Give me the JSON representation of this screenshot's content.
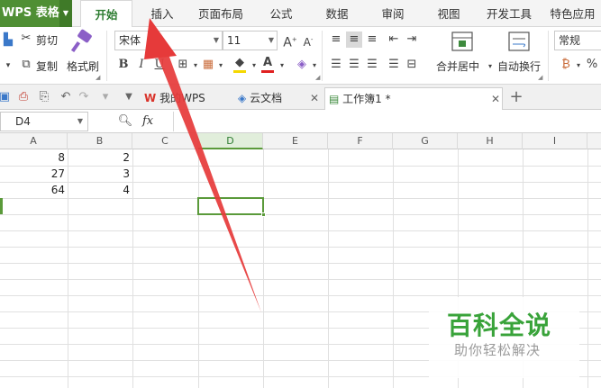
{
  "app": {
    "button_label": "WPS 表格"
  },
  "menu": {
    "tabs": [
      {
        "label": "开始"
      },
      {
        "label": "插入"
      },
      {
        "label": "页面布局"
      },
      {
        "label": "公式"
      },
      {
        "label": "数据"
      },
      {
        "label": "审阅"
      },
      {
        "label": "视图"
      },
      {
        "label": "开发工具"
      },
      {
        "label": "特色应用"
      }
    ],
    "active_tab": "开始"
  },
  "ribbon": {
    "cut_label": "剪切",
    "copy_label": "复制",
    "format_painter_label": "格式刷",
    "font_name": "宋体",
    "font_size": "11",
    "bold": "B",
    "italic": "I",
    "underline": "U",
    "merge_center_label": "合并居中",
    "wrap_text_label": "自动换行",
    "number_format": "常规",
    "percent": "%",
    "font_grow": "A",
    "font_shrink": "A",
    "font_color_letter": "A"
  },
  "doc_tabs": {
    "tabs": [
      {
        "label": "我的WPS",
        "icon": "wps-logo-icon",
        "color": "#d9332a"
      },
      {
        "label": "云文档",
        "icon": "cloud-cube-icon",
        "color": "#3a78c9"
      },
      {
        "label": "工作簿1 *",
        "icon": "workbook-icon",
        "color": "#3d8a3d"
      }
    ],
    "active_index": 2,
    "new_tab": "+"
  },
  "formula_bar": {
    "cell_ref": "D4",
    "fx": "fx"
  },
  "sheet": {
    "columns": [
      "A",
      "B",
      "C",
      "D",
      "E",
      "F",
      "G",
      "H",
      "I"
    ],
    "selected_column": "D",
    "rows": [
      [
        "8",
        "2"
      ],
      [
        "27",
        "3"
      ],
      [
        "64",
        "4"
      ]
    ]
  },
  "accent_colors": {
    "green": "#5a9a3a",
    "arrow_red": "#e63a3a"
  },
  "watermark": {
    "title": "百科全说",
    "subtitle": "助你轻松解决"
  }
}
